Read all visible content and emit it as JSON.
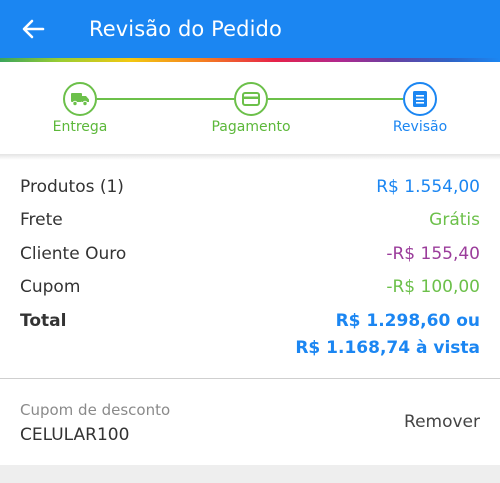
{
  "header": {
    "title": "Revisão do Pedido",
    "back_icon": "arrow-left-icon",
    "color": "#1b86f2"
  },
  "stepper": {
    "steps": [
      {
        "label": "Entrega",
        "icon": "truck-icon",
        "state": "done"
      },
      {
        "label": "Pagamento",
        "icon": "credit-card-icon",
        "state": "done"
      },
      {
        "label": "Revisão",
        "icon": "list-document-icon",
        "state": "current"
      }
    ],
    "done_color": "#6cc04a",
    "current_color": "#1b86f2"
  },
  "summary": {
    "rows": [
      {
        "label": "Produtos (1)",
        "value": "R$ 1.554,00",
        "color": "#1b86f2"
      },
      {
        "label": "Frete",
        "value": "Grátis",
        "color": "#6cc04a"
      },
      {
        "label": "Cliente Ouro",
        "value": "-R$ 155,40",
        "color": "#9b3d9b"
      },
      {
        "label": "Cupom",
        "value": "-R$ 100,00",
        "color": "#6cc04a"
      }
    ],
    "total": {
      "label": "Total",
      "value_line1": "R$ 1.298,60 ou",
      "value_line2": "R$ 1.168,74 à vista",
      "color": "#1b86f2"
    }
  },
  "coupon": {
    "label": "Cupom de desconto",
    "code": "CELULAR100",
    "remove_label": "Remover"
  }
}
